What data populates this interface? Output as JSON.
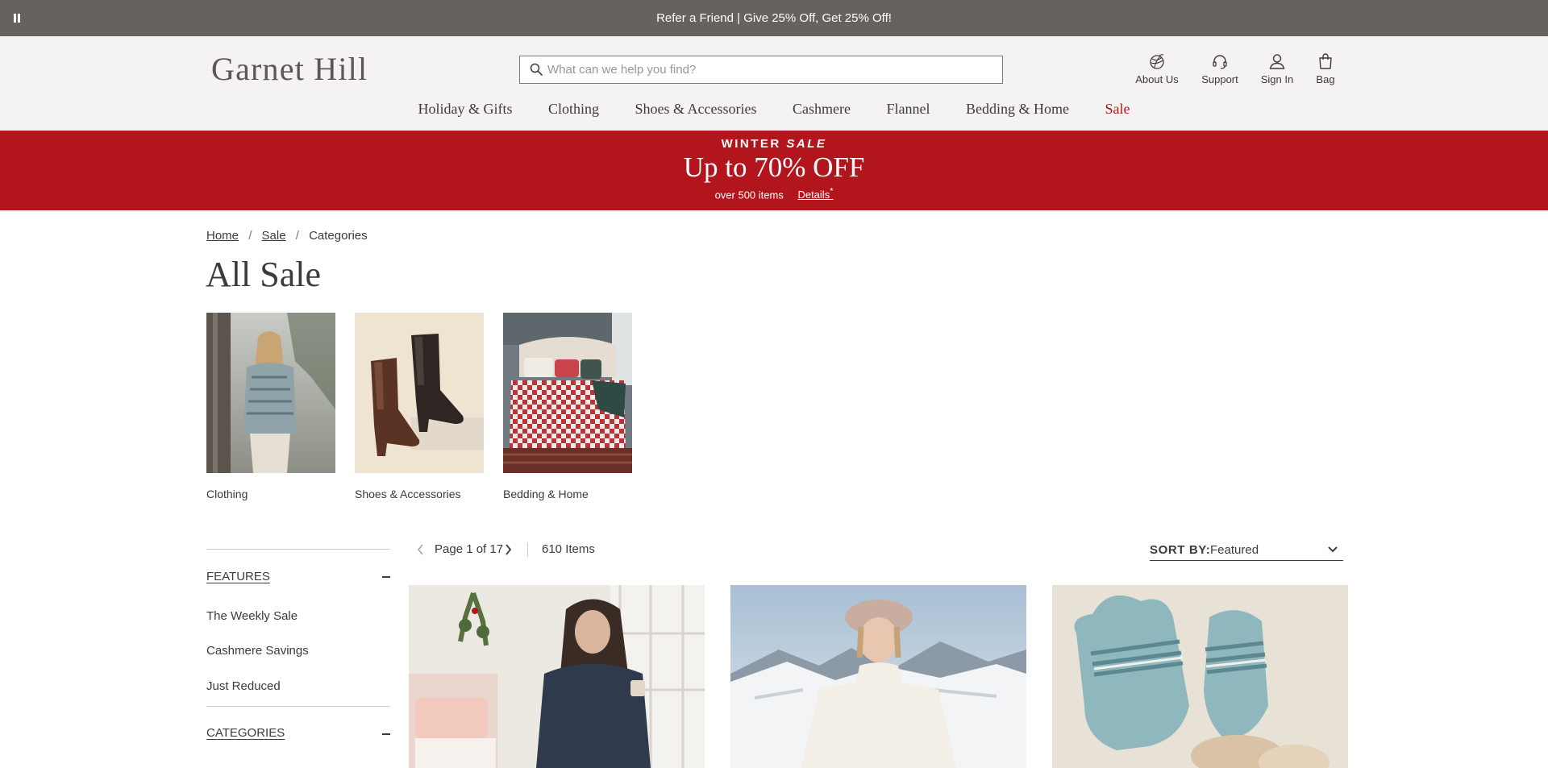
{
  "promo": {
    "text": "Refer a Friend | Give 25% Off, Get 25% Off!",
    "pause_icon": "pause-icon"
  },
  "header": {
    "logo": "Garnet Hill",
    "search_placeholder": "What can we help you find?",
    "utilities": [
      {
        "label": "About Us",
        "icon": "yarn-ball-icon"
      },
      {
        "label": "Support",
        "icon": "headset-icon"
      },
      {
        "label": "Sign In",
        "icon": "user-icon"
      },
      {
        "label": "Bag",
        "icon": "shopping-bag-icon"
      }
    ]
  },
  "nav": {
    "items": [
      "Holiday & Gifts",
      "Clothing",
      "Shoes & Accessories",
      "Cashmere",
      "Flannel",
      "Bedding & Home",
      "Sale"
    ]
  },
  "banner": {
    "kicker_prefix": "WINTER",
    "kicker_em": "SALE",
    "headline": "Up to 70% OFF",
    "sub": "over 500 items",
    "details": "Details",
    "details_mark": "*"
  },
  "breadcrumb": {
    "items": [
      "Home",
      "Sale",
      "Categories"
    ],
    "separator": "/"
  },
  "page": {
    "title": "All Sale"
  },
  "categories": [
    {
      "label": "Clothing"
    },
    {
      "label": "Shoes & Accessories"
    },
    {
      "label": "Bedding & Home"
    }
  ],
  "sidebar": {
    "features_heading": "FEATURES",
    "features_items": [
      "The Weekly Sale",
      "Cashmere Savings",
      "Just Reduced"
    ],
    "categories_heading": "CATEGORIES"
  },
  "toolbar": {
    "page_text": "Page 1 of 17",
    "item_count": "610 Items",
    "sort_label": "SORT BY:",
    "sort_value": "Featured"
  },
  "colors": {
    "promo_bar": "#67625e",
    "header_bg": "#f4f3f1",
    "sale_red": "#b3151c",
    "text_dark": "#3e3a37"
  }
}
